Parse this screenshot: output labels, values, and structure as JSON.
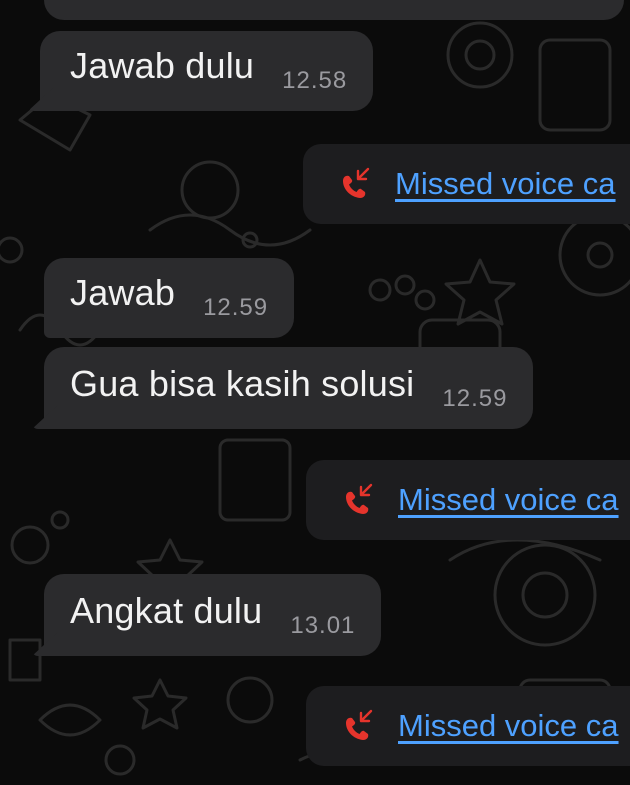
{
  "messages": [
    {
      "text": "Jawab dulu",
      "time": "12.58"
    },
    {
      "text": "Jawab",
      "time": "12.59"
    },
    {
      "text": "Gua bisa kasih solusi",
      "time": "12.59"
    },
    {
      "text": "Angkat dulu",
      "time": "13.01"
    }
  ],
  "calls": [
    {
      "label": "Missed voice ca",
      "icon": "missed-call-icon"
    },
    {
      "label": "Missed voice ca",
      "icon": "missed-call-icon"
    },
    {
      "label": "Missed voice ca",
      "icon": "missed-call-icon"
    }
  ],
  "colors": {
    "background": "#0b0b0b",
    "bubble": "#2b2b2d",
    "link": "#4ea1ff",
    "missed_call": "#e5342c",
    "timestamp": "#9a9a9f"
  }
}
